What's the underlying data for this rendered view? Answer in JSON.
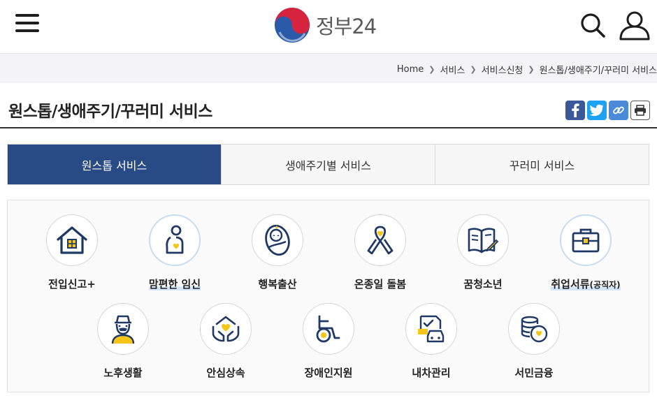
{
  "header": {
    "logo_text": "정부24",
    "menu_icon": "hamburger-icon",
    "search_icon": "search-icon",
    "user_icon": "user-icon"
  },
  "breadcrumb": {
    "items": [
      "Home",
      "서비스",
      "서비스신청",
      "원스톱/생애주기/꾸러미 서비스"
    ]
  },
  "page": {
    "title": "원스톱/생애주기/꾸러미 서비스",
    "share_icons": [
      "facebook-icon",
      "twitter-icon",
      "link-icon",
      "print-icon"
    ]
  },
  "tabs": [
    {
      "label": "원스톱 서비스",
      "active": true
    },
    {
      "label": "생애주기별 서비스",
      "active": false
    },
    {
      "label": "꾸러미 서비스",
      "active": false
    }
  ],
  "services": [
    {
      "label": "전입신고+",
      "icon": "house-icon"
    },
    {
      "label": "맘편한 임신",
      "icon": "pregnancy-icon"
    },
    {
      "label": "행복출산",
      "icon": "baby-icon"
    },
    {
      "label": "온종일 돌봄",
      "icon": "ribbon-icon"
    },
    {
      "label": "꿈청소년",
      "icon": "book-pen-icon"
    },
    {
      "label": "취업서류",
      "label_small": "(공직자)",
      "icon": "briefcase-icon"
    },
    {
      "label": "노후생활",
      "icon": "elder-icon"
    },
    {
      "label": "안심상속",
      "icon": "hands-heart-icon"
    },
    {
      "label": "장애인지원",
      "icon": "wheelchair-icon"
    },
    {
      "label": "내차관리",
      "icon": "car-document-icon"
    },
    {
      "label": "서민금융",
      "icon": "coins-icon"
    }
  ],
  "colors": {
    "primary": "#284a85",
    "icon_navy": "#1f3864",
    "icon_yellow": "#f5c518",
    "highlight": "#d3e6f9"
  }
}
